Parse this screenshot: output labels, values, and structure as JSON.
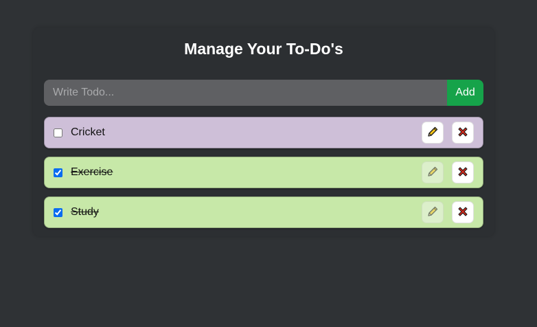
{
  "app": {
    "title": "Manage Your To-Do's"
  },
  "new_todo": {
    "placeholder": "Write Todo...",
    "value": "",
    "add_label": "Add"
  },
  "colors": {
    "background": "#2f3235",
    "card": "#2c2f32",
    "pending_item": "#cebfd8",
    "done_item": "#c7e8a8",
    "add_button": "#16a34a",
    "input": "#5f6063"
  },
  "todos": [
    {
      "text": "Cricket",
      "completed": false,
      "edit_icon": "pencil-icon",
      "delete_icon": "close-x-icon"
    },
    {
      "text": "Exercise",
      "completed": true,
      "edit_icon": "pencil-icon",
      "delete_icon": "close-x-icon"
    },
    {
      "text": "Study",
      "completed": true,
      "edit_icon": "pencil-icon",
      "delete_icon": "close-x-icon"
    }
  ]
}
